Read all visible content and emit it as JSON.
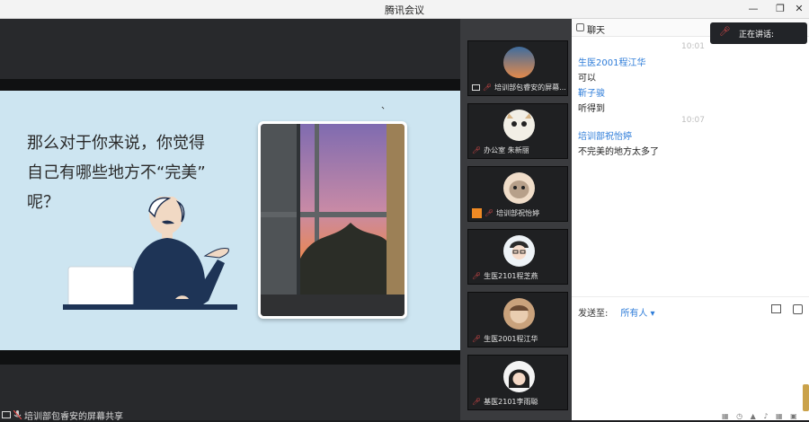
{
  "window": {
    "title": "腾讯会议"
  },
  "slide": {
    "lines": [
      "那么对于你来说，你觉得",
      "自己有哪些地方不“完美”",
      "呢？"
    ],
    "dot": "、"
  },
  "share_label": "培训部包睿安的屏幕共享",
  "participants": [
    {
      "name": "培训部包睿安的屏幕...",
      "sharing": true
    },
    {
      "name": "办公室 朱新丽"
    },
    {
      "name": "培训部祝怡婷",
      "host": true
    },
    {
      "name": "生医2101程芝燕"
    },
    {
      "name": "生医2001程江华"
    },
    {
      "name": "基医2101李雨聪"
    }
  ],
  "chat": {
    "header": "聊天",
    "speaking_label": "正在讲话:",
    "messages": [
      {
        "time": "10:01"
      },
      {
        "name": "生医2001程江华",
        "text": "可以"
      },
      {
        "name": "靳子骏",
        "text": "听得到"
      },
      {
        "time": "10:07"
      },
      {
        "name": "培训部祝怡婷",
        "text": "不完美的地方太多了"
      }
    ],
    "send_label": "发送至:",
    "send_target": "所有人 ▾"
  },
  "colors": {
    "slide_bg": "#cde5f1",
    "link": "#2f7dd9",
    "panel": "#3a3b3e"
  }
}
